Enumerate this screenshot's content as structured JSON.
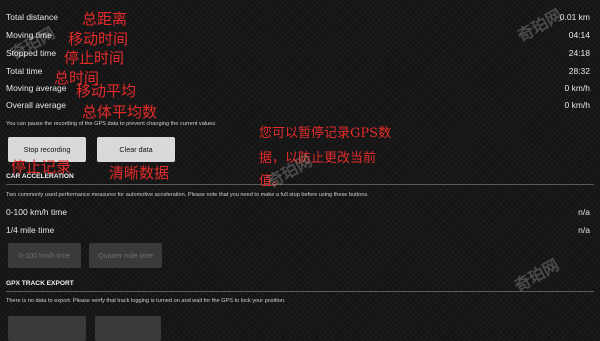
{
  "stats": [
    {
      "label": "Total distance",
      "value": "0.01 km"
    },
    {
      "label": "Moving time",
      "value": "04:14"
    },
    {
      "label": "Stopped time",
      "value": "24:18"
    },
    {
      "label": "Total time",
      "value": "28:32"
    },
    {
      "label": "Moving average",
      "value": "0 km/h"
    },
    {
      "label": "Overall average",
      "value": "0 km/h"
    }
  ],
  "pause_note": "You can pause the recording of the GPS data to prevent changing the current values.",
  "buttons": {
    "stop": "Stop recording",
    "clear": "Clear data"
  },
  "car_acceleration": {
    "title": "CAR ACCELERATION",
    "note": "Two commonly used performance measures for automotive acceleration. Please note that you need to make a full stop before using these buttons.",
    "rows": [
      {
        "label": "0-100 km/h time",
        "value": "n/a"
      },
      {
        "label": "1/4 mile time",
        "value": "n/a"
      }
    ],
    "buttons": {
      "zero100": "0-100 km/h time",
      "quarter": "Quarter mile time"
    }
  },
  "gpx_export": {
    "title": "GPX TRACK EXPORT",
    "note": "There is no data to export. Please verify that track logging is turned on and wait for the GPS to lock your position."
  },
  "annotations": {
    "total_distance": "总距离",
    "moving_time": "移动时间",
    "stopped_time": "停止时间",
    "total_time": "总时间",
    "moving_average": "移动平均",
    "overall_average": "总体平均数",
    "stop_recording": "停止记录",
    "clear_data": "清晰数据",
    "pause_line1_prefix": "您可以暂停记录",
    "pause_line1_gps": "GPS",
    "pause_line1_suffix": "数",
    "pause_line2": "据，以防止更改当前",
    "pause_line3": "值。"
  },
  "watermark": "奇珀网",
  "colors": {
    "annotation": "#e52b2b",
    "background": "#141414",
    "button_active": "#d9d9d9",
    "button_disabled": "#3a3a3a"
  }
}
